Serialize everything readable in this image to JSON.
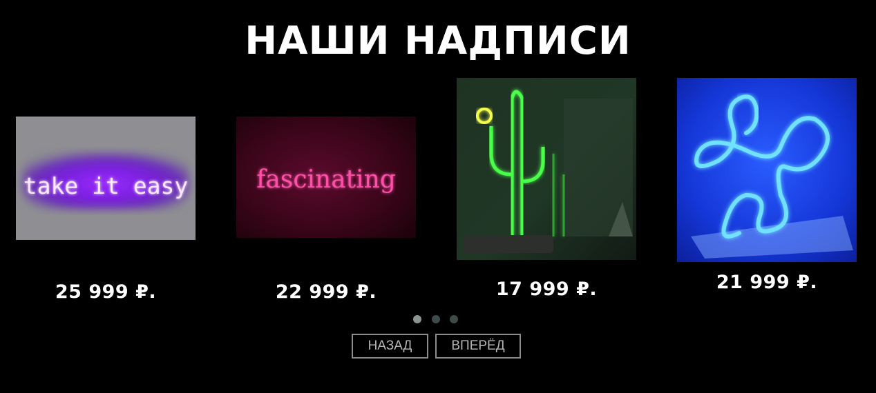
{
  "section": {
    "title": "НАШИ НАДПИСИ"
  },
  "products": [
    {
      "price": "25 999 ₽.",
      "sign_text": "take it easy",
      "neon_color": "#c35cff"
    },
    {
      "price": "22 999 ₽.",
      "sign_text": "fascinating",
      "neon_color": "#ff2d8f"
    },
    {
      "price": "17 999 ₽.",
      "sign_text": "",
      "neon_color": "#39ff3a"
    },
    {
      "price": "21 999 ₽.",
      "sign_text": "",
      "neon_color": "#3ab8ff"
    }
  ],
  "slider": {
    "dots": 3,
    "active_dot": 1,
    "prev_label": "НАЗАД",
    "next_label": "ВПЕРЁД"
  },
  "colors": {
    "background": "#000000",
    "text": "#ffffff",
    "button_border": "#8c8c8c",
    "button_text": "#b6b6b6",
    "dot_active": "#8a9592",
    "dot_inactive": "#3f4a4a"
  }
}
